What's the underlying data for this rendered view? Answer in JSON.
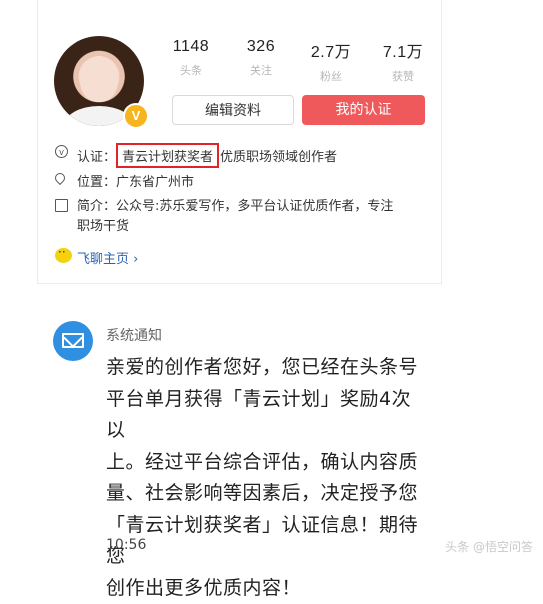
{
  "profile": {
    "stats": [
      {
        "num": "1148",
        "label": "头条"
      },
      {
        "num": "326",
        "label": "关注"
      },
      {
        "num": "2.7万",
        "label": "粉丝"
      },
      {
        "num": "7.1万",
        "label": "获赞"
      }
    ],
    "badge": "V",
    "edit_button": "编辑资料",
    "cert_button": "我的认证",
    "cert_prefix": "认证：",
    "cert_highlight": "青云计划获奖者",
    "cert_rest": "优质职场领域创作者",
    "location": "位置：广东省广州市",
    "intro_line1": "简介：公众号:苏乐爱写作，多平台认证优质作者，专注",
    "intro_line2": "职场干货",
    "feiliao_link": "飞聊主页 ›",
    "icons": {
      "cert": "verified-v-icon",
      "location": "location-pin-icon",
      "intro": "document-icon",
      "feiliao": "feiliao-chat-icon",
      "notif": "envelope-icon"
    }
  },
  "notification": {
    "title": "系统通知",
    "body_lines": [
      "亲爱的创作者您好，您已经在头条号",
      "平台单月获得「青云计划」奖励4次以",
      "上。经过平台综合评估，确认内容质",
      "量、社会影响等因素后，决定授予您",
      "「青云计划获奖者」认证信息！期待您",
      "创作出更多优质内容！"
    ],
    "time": "10:56"
  },
  "watermark": "头条 @悟空问答",
  "colors": {
    "accent": "#f0595c",
    "highlight": "#e0242a",
    "notif_blue": "#2f8fe0",
    "badge": "#f6b51e",
    "link": "#2a66b3"
  }
}
